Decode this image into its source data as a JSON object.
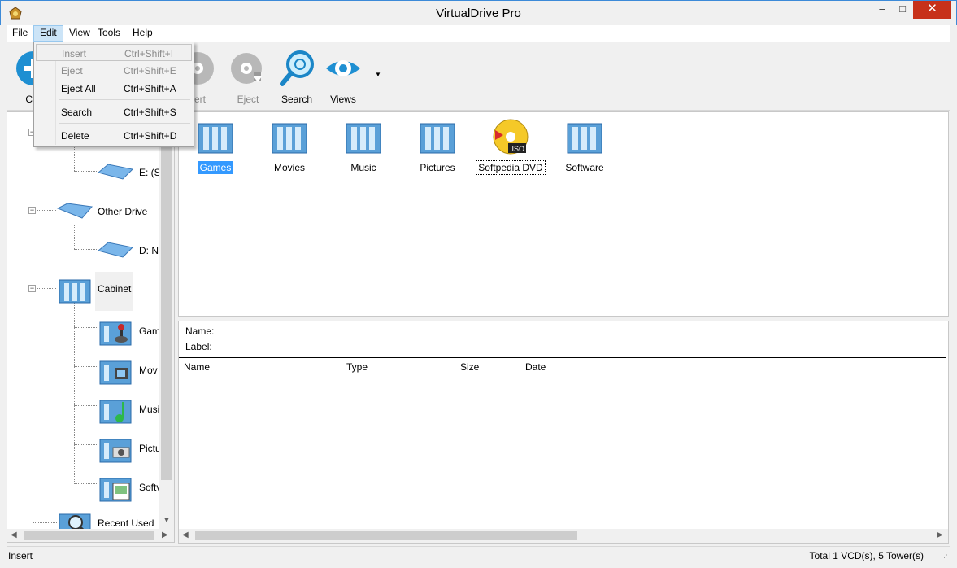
{
  "window": {
    "title": "VirtualDrive Pro",
    "controls": {
      "minimize": "–",
      "maximize": "□",
      "close": "✕"
    }
  },
  "menubar": {
    "items": [
      {
        "label": "File"
      },
      {
        "label": "Edit",
        "active": true
      },
      {
        "label": "View"
      },
      {
        "label": "Tools"
      },
      {
        "label": "Help"
      }
    ]
  },
  "edit_menu": {
    "items": [
      {
        "label": "Insert",
        "shortcut": "Ctrl+Shift+I",
        "disabled": true,
        "hovered": true
      },
      {
        "label": "Eject",
        "shortcut": "Ctrl+Shift+E",
        "disabled": true
      },
      {
        "label": "Eject All",
        "shortcut": "Ctrl+Shift+A",
        "disabled": false
      },
      {
        "label": "Search",
        "shortcut": "Ctrl+Shift+S",
        "disabled": false
      },
      {
        "label": "Delete",
        "shortcut": "Ctrl+Shift+D",
        "disabled": false
      }
    ]
  },
  "toolbar": {
    "create_label": "Cre",
    "insert_label": "sert",
    "eject_label": "Eject",
    "search_label": "Search",
    "views_label": "Views",
    "views_arrow": "▼",
    "icons": {
      "create": "plus-icon",
      "insert": "disc-icon",
      "eject": "disc-eject-icon",
      "search": "magnifier-icon",
      "views": "eye-icon"
    }
  },
  "tree": {
    "collapse_symbol": "−",
    "items": [
      {
        "label": "E: (So",
        "icon": "drive-icon"
      },
      {
        "label": "Other Drive",
        "icon": "drive-icon"
      },
      {
        "label": "D: Ne",
        "icon": "drive-icon"
      },
      {
        "label": "Cabinet",
        "icon": "cabinet-icon"
      },
      {
        "label": "Gam",
        "icon": "games-tower-icon"
      },
      {
        "label": "Mov",
        "icon": "movies-tower-icon"
      },
      {
        "label": "Musi",
        "icon": "music-tower-icon"
      },
      {
        "label": "Pictu",
        "icon": "pictures-tower-icon"
      },
      {
        "label": "Softv",
        "icon": "software-tower-icon"
      },
      {
        "label": "Recent Used",
        "icon": "search-tower-icon"
      }
    ],
    "scroll_down": "▼"
  },
  "main_items": [
    {
      "label": "Games",
      "icon": "tower-icon",
      "selected": true
    },
    {
      "label": "Movies",
      "icon": "tower-icon"
    },
    {
      "label": "Music",
      "icon": "tower-icon"
    },
    {
      "label": "Pictures",
      "icon": "tower-icon"
    },
    {
      "label": "Softpedia DVD",
      "icon": "iso-disc-icon",
      "focused": true
    },
    {
      "label": "Software",
      "icon": "tower-icon"
    }
  ],
  "details": {
    "name_label": "Name:",
    "label_label": "Label:",
    "columns": [
      "Name",
      "Type",
      "Size",
      "Date"
    ]
  },
  "scroll_arrows": {
    "left": "◀",
    "right": "▶"
  },
  "status": {
    "left": "Insert",
    "right": "Total 1 VCD(s), 5 Tower(s)",
    "grip": "⋰"
  }
}
